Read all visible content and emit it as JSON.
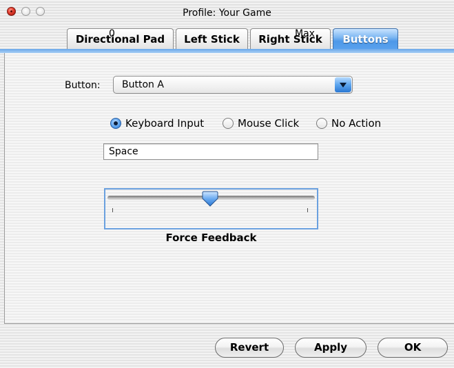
{
  "window": {
    "title": "Profile: Your Game"
  },
  "tabs": [
    {
      "label": "Directional Pad",
      "selected": false
    },
    {
      "label": "Left Stick",
      "selected": false
    },
    {
      "label": "Right Stick",
      "selected": false
    },
    {
      "label": "Buttons",
      "selected": true
    }
  ],
  "button_select": {
    "label": "Button:",
    "value": "Button A"
  },
  "action_radios": [
    {
      "label": "Keyboard Input",
      "selected": true
    },
    {
      "label": "Mouse Click",
      "selected": false
    },
    {
      "label": "No Action",
      "selected": false
    }
  ],
  "keyboard_input": {
    "value": "Space"
  },
  "force_feedback": {
    "title": "Force Feedback",
    "min_label": "0",
    "max_label": "Max",
    "level": 0.5
  },
  "footer": {
    "revert_label": "Revert",
    "apply_label": "Apply",
    "ok_label": "OK"
  },
  "colors": {
    "selected_tab": "#4d98e8",
    "aqua_blue": "#5aa2ee",
    "close_button": "#e23a2c"
  }
}
